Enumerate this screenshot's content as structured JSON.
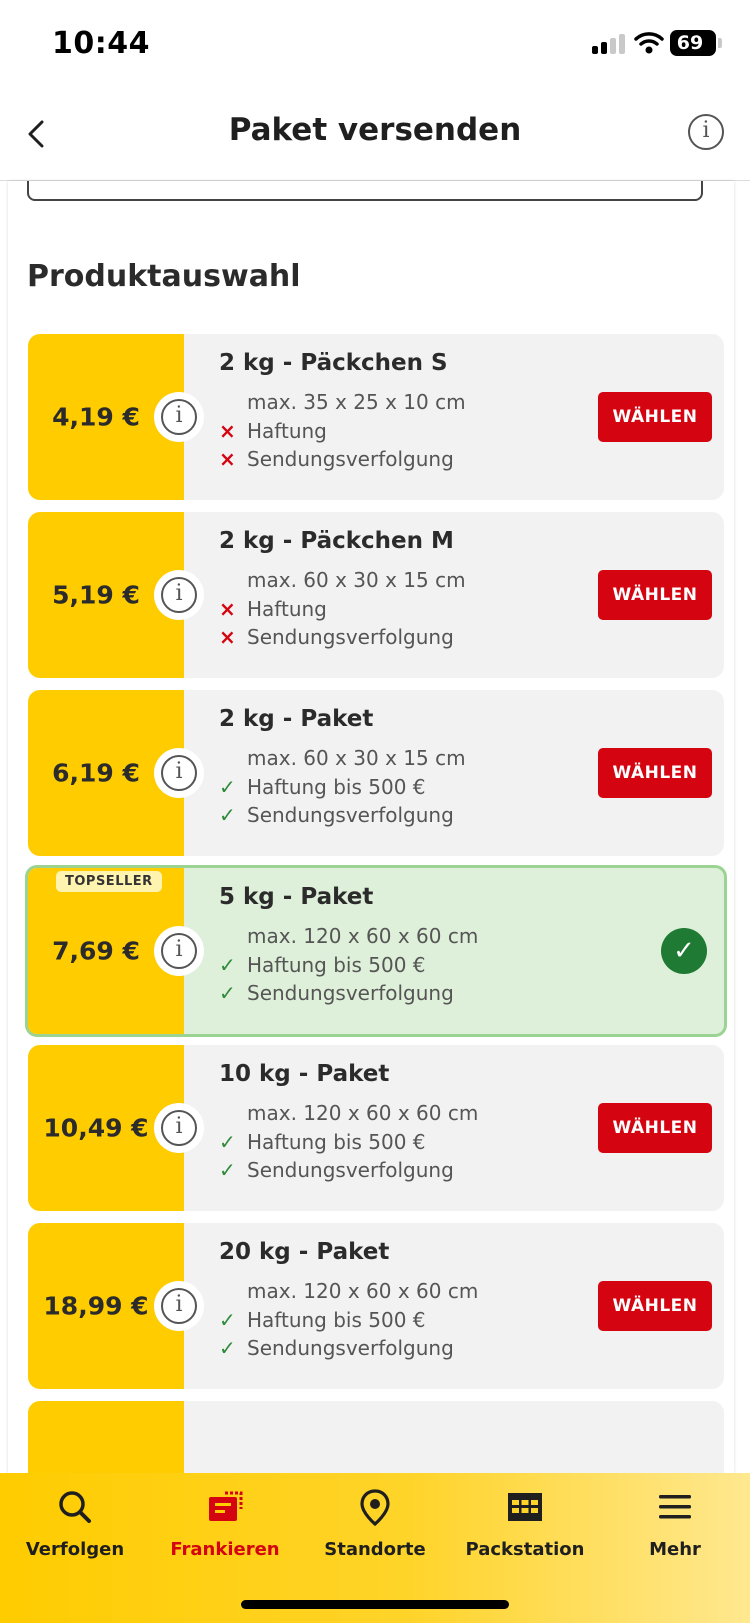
{
  "status_bar": {
    "time": "10:44",
    "battery": "69"
  },
  "nav": {
    "title": "Paket versenden"
  },
  "section": {
    "title": "Produktauswahl"
  },
  "products": [
    {
      "price": "4,19 €",
      "name": "2 kg - Päckchen S",
      "dims": "max. 35 x 25 x 10 cm",
      "liability": "Haftung",
      "liability_included": false,
      "tracking": "Sendungsverfolgung",
      "tracking_included": false,
      "selected": false,
      "choose_label": "WÄHLEN"
    },
    {
      "price": "5,19 €",
      "name": "2 kg - Päckchen M",
      "dims": "max. 60 x 30 x 15 cm",
      "liability": "Haftung",
      "liability_included": false,
      "tracking": "Sendungsverfolgung",
      "tracking_included": false,
      "selected": false,
      "choose_label": "WÄHLEN"
    },
    {
      "price": "6,19 €",
      "name": "2 kg - Paket",
      "dims": "max. 60 x 30 x 15 cm",
      "liability": "Haftung bis 500 €",
      "liability_included": true,
      "tracking": "Sendungsverfolgung",
      "tracking_included": true,
      "selected": false,
      "choose_label": "WÄHLEN"
    },
    {
      "price": "7,69 €",
      "name": "5 kg - Paket",
      "badge": "TOPSELLER",
      "dims": "max. 120 x 60 x 60 cm",
      "liability": "Haftung bis 500 €",
      "liability_included": true,
      "tracking": "Sendungsverfolgung",
      "tracking_included": true,
      "selected": true
    },
    {
      "price": "10,49 €",
      "name": "10 kg - Paket",
      "dims": "max. 120 x 60 x 60 cm",
      "liability": "Haftung bis 500 €",
      "liability_included": true,
      "tracking": "Sendungsverfolgung",
      "tracking_included": true,
      "selected": false,
      "choose_label": "WÄHLEN"
    },
    {
      "price": "18,99 €",
      "name": "20 kg - Paket",
      "dims": "max. 120 x 60 x 60 cm",
      "liability": "Haftung bis 500 €",
      "liability_included": true,
      "tracking": "Sendungsverfolgung",
      "tracking_included": true,
      "selected": false,
      "choose_label": "WÄHLEN"
    }
  ],
  "icons": {
    "info": "info-icon",
    "cross": "×",
    "check": "✓"
  },
  "colors": {
    "dhl_yellow": "#ffcc00",
    "dhl_red": "#d40511",
    "selected_bg": "#dff0da",
    "check_green": "#1f7a34"
  },
  "tabbar": {
    "tabs": [
      {
        "label": "Verfolgen",
        "icon": "search-icon",
        "active": false
      },
      {
        "label": "Frankieren",
        "icon": "stamp-icon",
        "active": true
      },
      {
        "label": "Standorte",
        "icon": "location-pin-icon",
        "active": false
      },
      {
        "label": "Packstation",
        "icon": "packstation-icon",
        "active": false
      },
      {
        "label": "Mehr",
        "icon": "menu-icon",
        "active": false
      }
    ]
  }
}
